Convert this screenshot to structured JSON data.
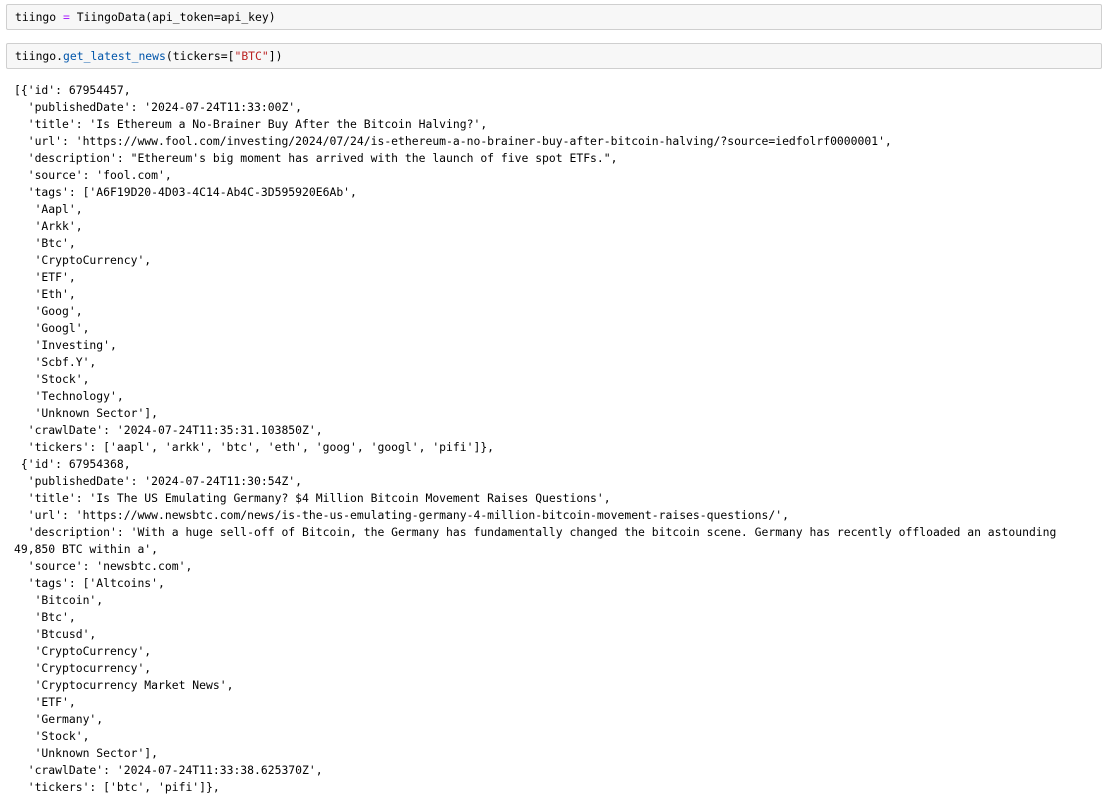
{
  "cells": [
    {
      "tokens": [
        {
          "text": "tiingo",
          "cls": "tok-var"
        },
        {
          "text": " = ",
          "cls": "tok-op"
        },
        {
          "text": "TiingoData(api_token=api_key)",
          "cls": "tok-var"
        }
      ]
    },
    {
      "tokens": [
        {
          "text": "tiingo.",
          "cls": "tok-var"
        },
        {
          "text": "get_latest_news",
          "cls": "tok-fn"
        },
        {
          "text": "(tickers=[",
          "cls": "tok-punct"
        },
        {
          "text": "\"BTC\"",
          "cls": "tok-str"
        },
        {
          "text": "])",
          "cls": "tok-punct"
        }
      ]
    }
  ],
  "output_lines": [
    "[{'id': 67954457,",
    "  'publishedDate': '2024-07-24T11:33:00Z',",
    "  'title': 'Is Ethereum a No-Brainer Buy After the Bitcoin Halving?',",
    "  'url': 'https://www.fool.com/investing/2024/07/24/is-ethereum-a-no-brainer-buy-after-bitcoin-halving/?source=iedfolrf0000001',",
    "  'description': \"Ethereum's big moment has arrived with the launch of five spot ETFs.\",",
    "  'source': 'fool.com',",
    "  'tags': ['A6F19D20-4D03-4C14-Ab4C-3D595920E6Ab',",
    "   'Aapl',",
    "   'Arkk',",
    "   'Btc',",
    "   'CryptoCurrency',",
    "   'ETF',",
    "   'Eth',",
    "   'Goog',",
    "   'Googl',",
    "   'Investing',",
    "   'Scbf.Y',",
    "   'Stock',",
    "   'Technology',",
    "   'Unknown Sector'],",
    "  'crawlDate': '2024-07-24T11:35:31.103850Z',",
    "  'tickers': ['aapl', 'arkk', 'btc', 'eth', 'goog', 'googl', 'pifi']},",
    " {'id': 67954368,",
    "  'publishedDate': '2024-07-24T11:30:54Z',",
    "  'title': 'Is The US Emulating Germany? $4 Million Bitcoin Movement Raises Questions',",
    "  'url': 'https://www.newsbtc.com/news/is-the-us-emulating-germany-4-million-bitcoin-movement-raises-questions/',",
    "  'description': 'With a huge sell-off of Bitcoin, the Germany has fundamentally changed the bitcoin scene. Germany has recently offloaded an astounding",
    "49,850 BTC within a',",
    "  'source': 'newsbtc.com',",
    "  'tags': ['Altcoins',",
    "   'Bitcoin',",
    "   'Btc',",
    "   'Btcusd',",
    "   'CryptoCurrency',",
    "   'Cryptocurrency',",
    "   'Cryptocurrency Market News',",
    "   'ETF',",
    "   'Germany',",
    "   'Stock',",
    "   'Unknown Sector'],",
    "  'crawlDate': '2024-07-24T11:33:38.625370Z',",
    "  'tickers': ['btc', 'pifi']},"
  ]
}
